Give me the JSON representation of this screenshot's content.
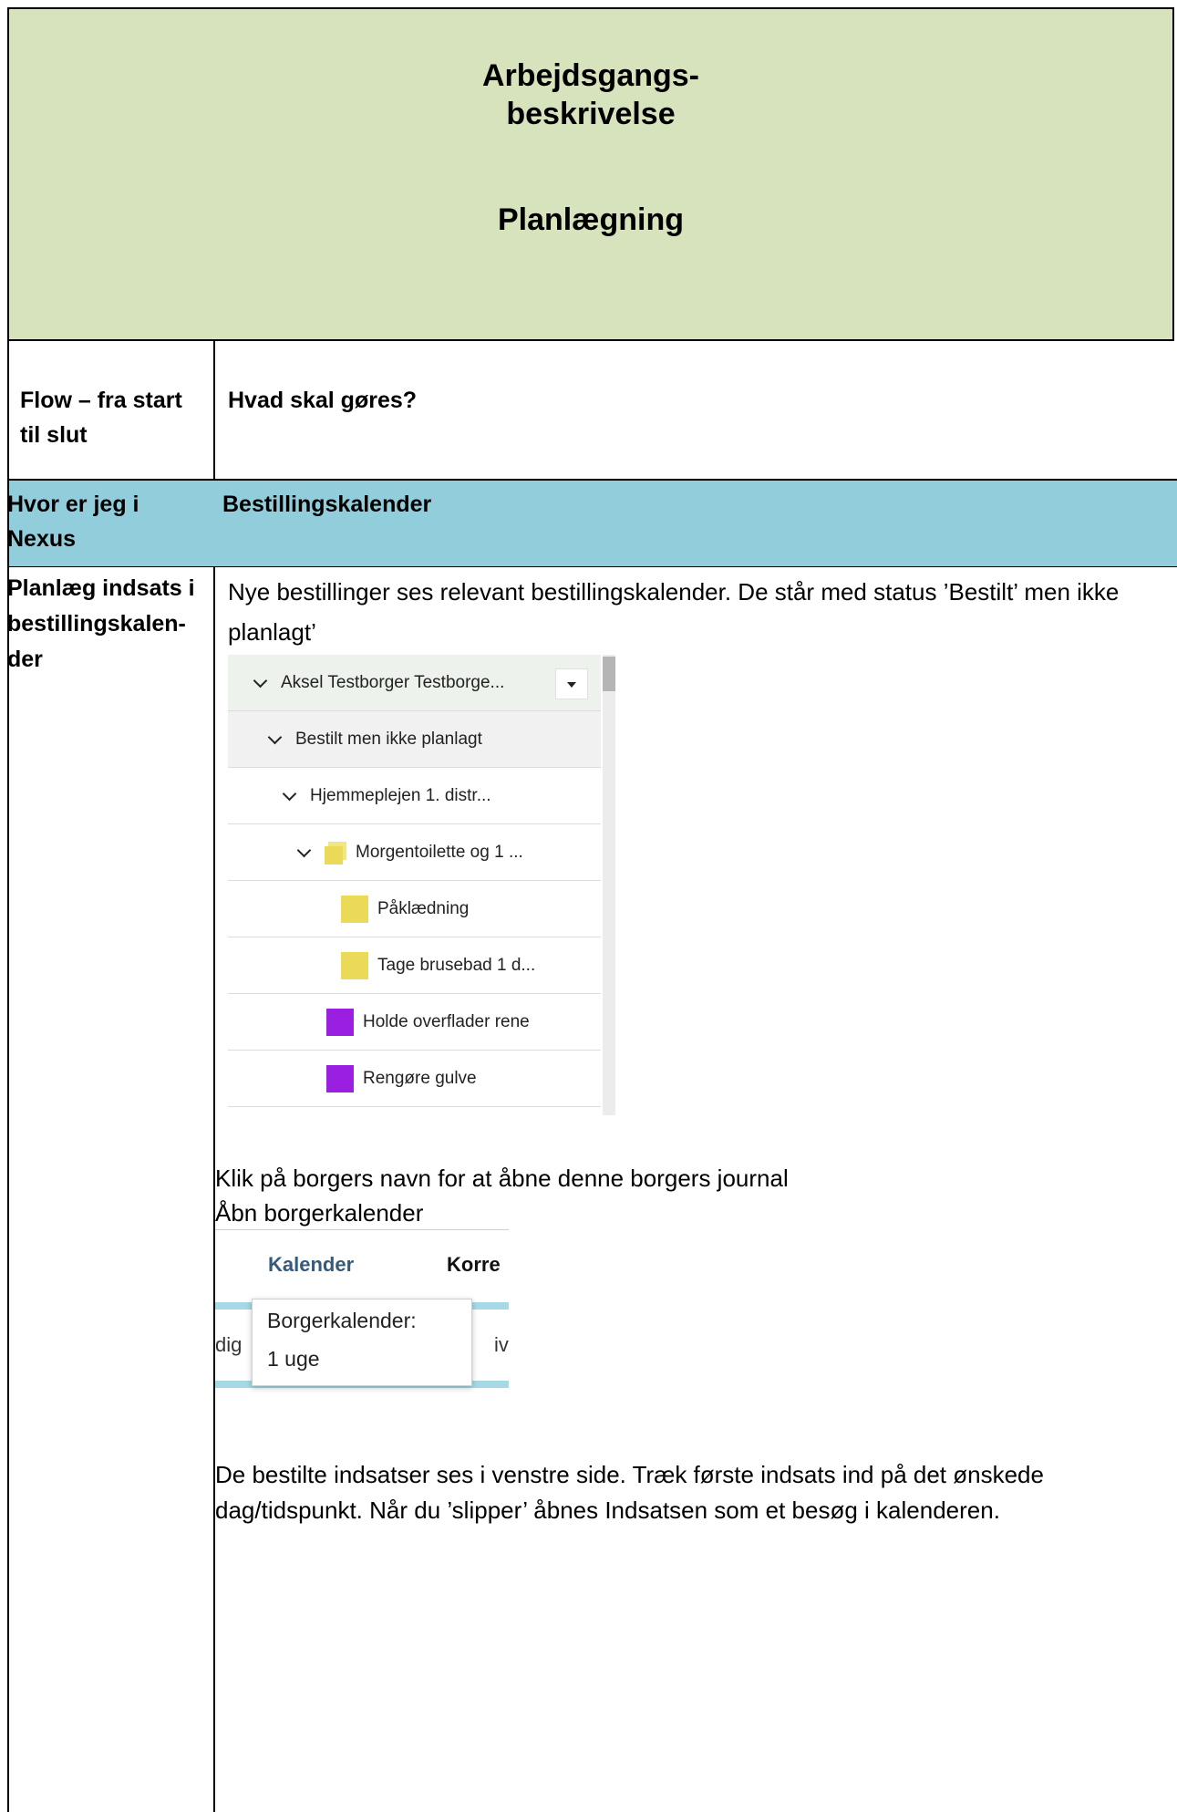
{
  "header": {
    "title_line1": "Arbejdsgangs-",
    "title_line2": "beskrivelse",
    "subtitle": "Planlægning"
  },
  "table_head": {
    "left": "Flow – fra start til slut",
    "right": "Hvad skal gøres?"
  },
  "nexus_row": {
    "left": "Hvor er jeg i Nexus",
    "right": "Bestillingskalender"
  },
  "step": {
    "left": "Planlæg indsats i bestillingskalen-der",
    "intro": "Nye bestillinger ses relevant bestillingskalender. De står med status ’Bestilt’ men ikke planlagt’",
    "tree": {
      "items": [
        {
          "label": "Aksel Testborger Testborge...",
          "level": 0,
          "marker": "chevron"
        },
        {
          "label": "Bestilt men ikke planlagt",
          "level": 1,
          "marker": "chevron"
        },
        {
          "label": "Hjemmeplejen 1. distr...",
          "level": 2,
          "marker": "chevron"
        },
        {
          "label": "Morgentoilette og 1 ...",
          "level": 3,
          "marker": "stack"
        },
        {
          "label": "Påklædning",
          "level": 4,
          "marker": "yellow"
        },
        {
          "label": "Tage brusebad 1 d...",
          "level": 4,
          "marker": "yellow"
        },
        {
          "label": "Holde overflader rene",
          "level": 3,
          "marker": "purple"
        },
        {
          "label": "Rengøre gulve",
          "level": 3,
          "marker": "purple"
        }
      ],
      "colors": {
        "yellow": "#ebd958",
        "purple": "#9b1fe0",
        "selected_row": "#edf3ec"
      }
    },
    "click_line1": "Klik på borgers navn for at åbne denne borgers journal",
    "click_line2": "Åbn borgerkalender",
    "kalender": {
      "tab": "Kalender",
      "tab2": "Korre",
      "frag_left": "dig",
      "frag_right": "iv",
      "popup_line1": "Borgerkalender:",
      "popup_line2": "1 uge"
    },
    "drag_text": "De bestilte indsatser ses i venstre side. Træk første indsats ind på det ønskede dag/tidspunkt. Når du ’slipper’ åbnes Indsatsen som et besøg i kalenderen."
  },
  "colors": {
    "header_bg": "#d6e3bc",
    "nexus_bg": "#92cddc"
  }
}
